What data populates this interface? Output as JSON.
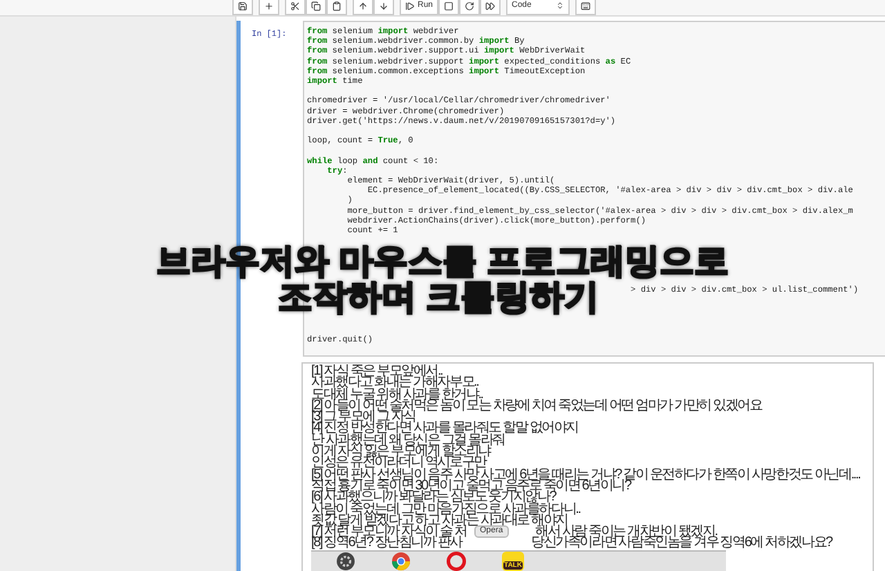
{
  "toolbar": {
    "run_label": "Run",
    "cell_type": "Code"
  },
  "cell": {
    "prompt": "In [1]:",
    "code": [
      {
        "kind": "line",
        "text": "**from** selenium **import** webdriver"
      },
      {
        "kind": "line",
        "text": "**from** selenium.webdriver.common.by **import** By"
      },
      {
        "kind": "line",
        "text": "**from** selenium.webdriver.support.ui **import** WebDriverWait"
      },
      {
        "kind": "line",
        "text": "**from** selenium.webdriver.support **import** expected_conditions **as** EC"
      },
      {
        "kind": "line",
        "text": "**from** selenium.common.exceptions **import** TimeoutException"
      },
      {
        "kind": "line",
        "text": "**import** time"
      },
      {
        "kind": "blank"
      },
      {
        "kind": "line",
        "text": "chromedriver = '/usr/local/Cellar/chromedriver/chromedriver'"
      },
      {
        "kind": "line",
        "text": "driver = webdriver.Chrome(chromedriver)"
      },
      {
        "kind": "line",
        "text": "driver.get('https://news.v.daum.net/v/20190709165157301?d=y')"
      },
      {
        "kind": "blank"
      },
      {
        "kind": "line",
        "text": "loop, count = **True**, 0"
      },
      {
        "kind": "blank"
      },
      {
        "kind": "line",
        "text": "**while** loop **and** count < 10:"
      },
      {
        "kind": "line",
        "text": "    **try**:"
      },
      {
        "kind": "line",
        "text": "        element = WebDriverWait(driver, 5).until("
      },
      {
        "kind": "line",
        "text": "            EC.presence_of_element_located((By.CSS_SELECTOR, '#alex-area > div > div > div.cmt_box > div.ale"
      },
      {
        "kind": "line",
        "text": "        )"
      },
      {
        "kind": "line",
        "text": "        more_button = driver.find_element_by_css_selector('#alex-area > div > div > div.cmt_box > div.alex_m"
      },
      {
        "kind": "line",
        "text": "        webdriver.ActionChains(driver).click(more_button).perform()"
      },
      {
        "kind": "line",
        "text": "        count += 1"
      },
      {
        "kind": "blank"
      },
      {
        "kind": "blank"
      },
      {
        "kind": "blank"
      },
      {
        "kind": "blank"
      },
      {
        "kind": "blank"
      },
      {
        "kind": "line",
        "text": "                                                                > div > div > div.cmt_box > ul.list_comment')"
      },
      {
        "kind": "blank"
      },
      {
        "kind": "blank"
      },
      {
        "kind": "blank"
      },
      {
        "kind": "blank"
      },
      {
        "kind": "line",
        "text": "driver.quit()"
      }
    ],
    "output": [
      {
        "text": "[1] 자식 죽은 부모앞에서.."
      },
      {
        "text": "사과했다고 화내는 가해자부모.."
      },
      {
        "text": "도대체 누굴 위해 사과를 한거냐.."
      },
      {
        "text": "[2] 아들이 어떤 술처먹은 놈이 모는 차량에 치여 죽었는데 어떤 엄마가 가만히 있겠어요"
      },
      {
        "text": "[3] 그 부모에 그 자식"
      },
      {
        "text": "[4] 진정 반성한다면 사과를 몰라줘도 할말 없어야지"
      },
      {
        "text": "난 사과했는데 왜 당신은 그걸 몰라줘"
      },
      {
        "text": "이게 자식 잃은 부모에게 할소리냐"
      },
      {
        "text": "인성은 유전이라더니 역시로구만"
      },
      {
        "text": "[5] 어떤 판사 선생님이 음주 사망 사고에 6년을 때리는 거냐? 같이 운전하다가 한쪽이 사망한것도 아닌데...."
      },
      {
        "text": "직접 흉기로 죽이면 30년이고 술먹고 음주로 죽이면 6년이니?"
      },
      {
        "text": "[6] 사과했으니까 봐달라는 심보도 웃기지않나?"
      },
      {
        "text": "사람이 죽었는데 그만 마음가짐으로 사과를하다니.."
      },
      {
        "text": "죗값 달게 받겠다고 하고 사과는 사과대로 해야지"
      },
      {
        "text": "[7] 저런 부모니까 자식이 술 처",
        "tail": "해서 사람 죽이는 개차반이 됐겠지."
      },
      {
        "text": "[8] 징역6년? 장난침니까 판사",
        "tail": "당신가족이라면 사람죽인놈을 겨우 징역6에 처하겠나요?"
      }
    ]
  },
  "caption": [
    "브라우저와 마우스를 프로그래밍으로",
    "조작하며 크롤링하기"
  ],
  "dock": {
    "tooltip": "Opera",
    "talk_label": "TALK"
  }
}
